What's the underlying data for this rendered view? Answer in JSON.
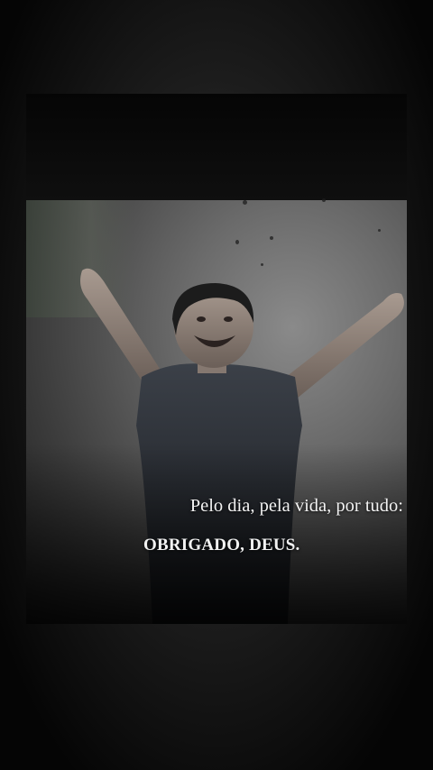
{
  "quote": {
    "line1": "Pelo dia, pela vida, por tudo:",
    "line2": "OBRIGADO, DEUS."
  },
  "colors": {
    "background": "#111111",
    "text": "#f2f2f2"
  }
}
